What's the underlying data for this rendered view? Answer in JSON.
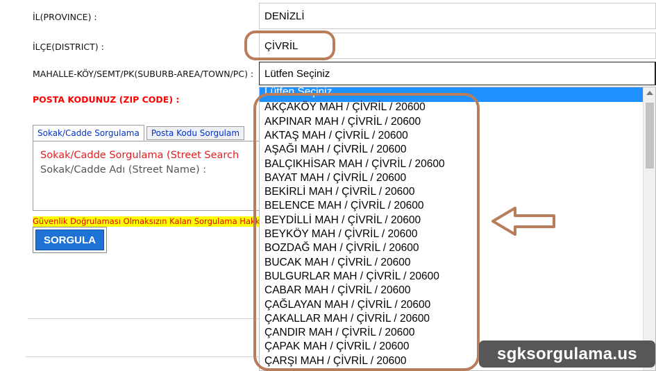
{
  "form": {
    "province_label": "İL(PROVINCE) :",
    "province_value": "DENİZLİ",
    "district_label": "İLÇE(DISTRICT) :",
    "district_value": "ÇİVRİL",
    "neighborhood_label": "MAHALLE-KÖY/SEMT/PK(SUBURB-AREA/TOWN/PC) :",
    "neighborhood_selected": "Lütfen Seçiniz",
    "zip_label": "POSTA KODUNUZ (ZIP CODE) :"
  },
  "tabs": [
    {
      "label": "Sokak/Cadde Sorgulama"
    },
    {
      "label": "Posta Kodu Sorgulam"
    }
  ],
  "panel": {
    "title": "Sokak/Cadde Sorgulama (Street Search",
    "subtitle": "Sokak/Cadde Adı (Street Name) :"
  },
  "security_note": "Güvenlik Doğrulaması Olmaksızın Kalan Sorgulama Hakkı",
  "search_button": "SORGULA",
  "dropdown": {
    "items": [
      "Lütfen Seçiniz",
      "AKÇAKÖY MAH / ÇİVRİL / 20600",
      "AKPINAR MAH / ÇİVRİL / 20600",
      "AKTAŞ MAH / ÇİVRİL / 20600",
      "AŞAĞI MAH / ÇİVRİL / 20600",
      "BALÇIKHİSAR MAH / ÇİVRİL / 20600",
      "BAYAT MAH / ÇİVRİL / 20600",
      "BEKİRLİ MAH / ÇİVRİL / 20600",
      "BELENCE MAH / ÇİVRİL / 20600",
      "BEYDİLLİ MAH / ÇİVRİL / 20600",
      "BEYKÖY MAH / ÇİVRİL / 20600",
      "BOZDAĞ MAH / ÇİVRİL / 20600",
      "BUCAK MAH / ÇİVRİL / 20600",
      "BULGURLAR MAH / ÇİVRİL / 20600",
      "CABAR MAH / ÇİVRİL / 20600",
      "ÇAĞLAYAN MAH / ÇİVRİL / 20600",
      "ÇAKALLAR MAH / ÇİVRİL / 20600",
      "ÇANDIR MAH / ÇİVRİL / 20600",
      "ÇAPAK MAH / ÇİVRİL / 20600",
      "ÇARŞI MAH / ÇİVRİL / 20600"
    ],
    "selected_index": 0
  },
  "watermark": "sgksorgulama.us",
  "colors": {
    "annotation": "#b87d5a",
    "selected": "#1e90ff",
    "button": "#1f73d6",
    "error_text": "#ff0000",
    "highlight": "#ffff00"
  }
}
